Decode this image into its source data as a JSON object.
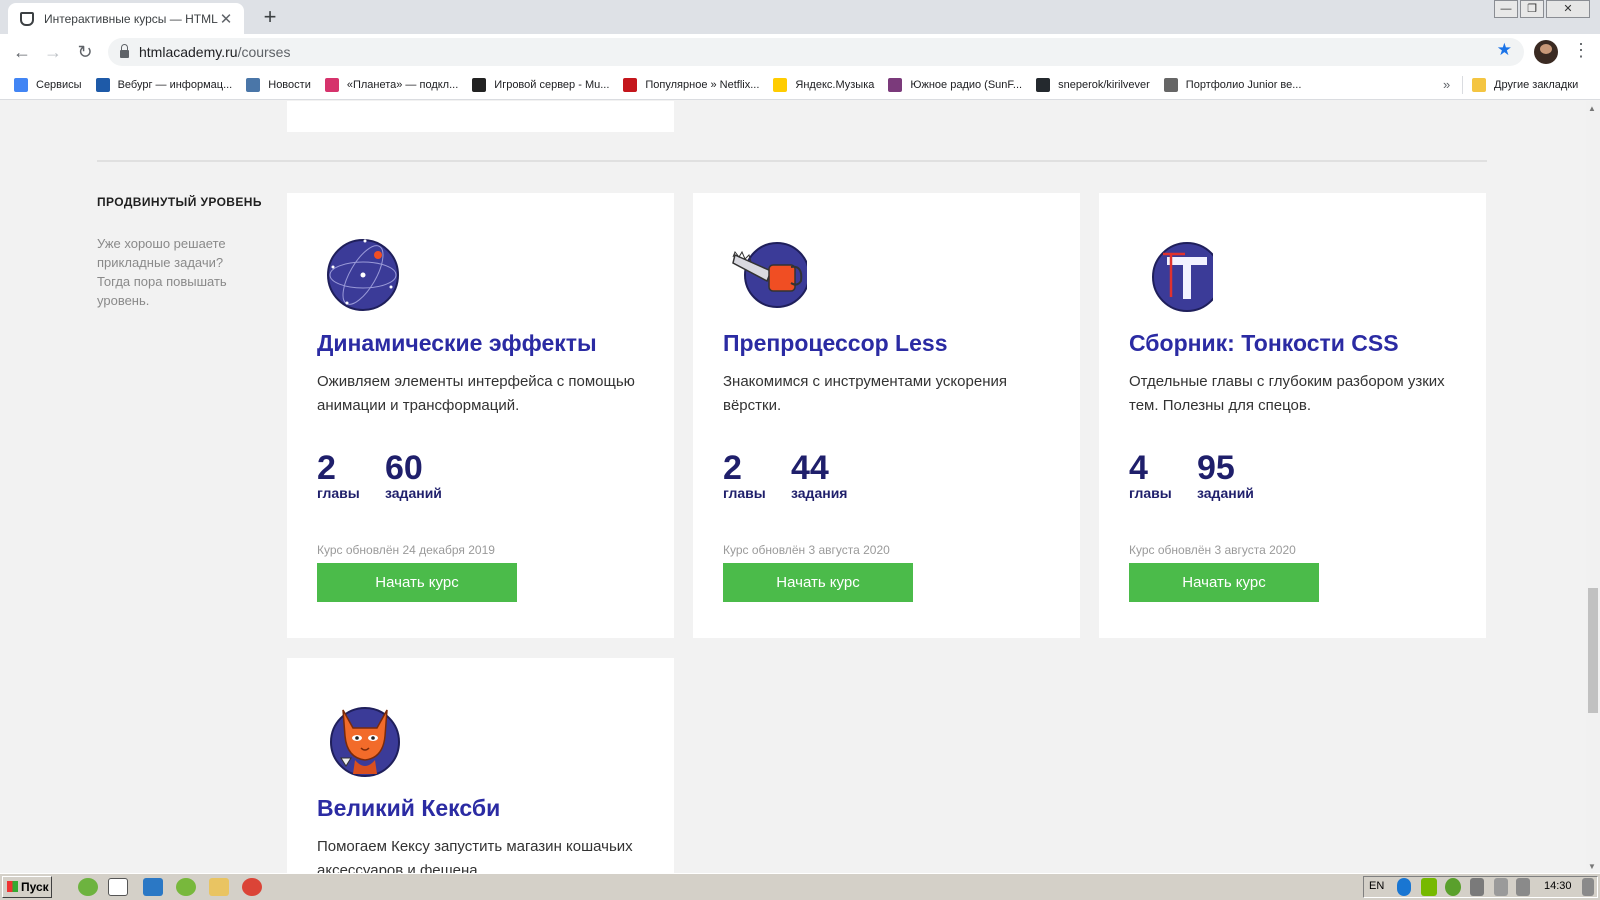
{
  "browser": {
    "tab_title": "Интерактивные курсы — HTML Ac",
    "tab_close": "✕",
    "new_tab": "+",
    "url_host": "htmlacademy.ru",
    "url_path": "/courses",
    "nav": {
      "back": "←",
      "forward": "→",
      "reload": "↻"
    },
    "bookmark_star": "★",
    "menu": "⋮",
    "window_controls": {
      "minimize": "—",
      "restore": "❐",
      "close": "✕"
    }
  },
  "bookmarks": {
    "items": [
      {
        "label": "Сервисы",
        "icon_color": "#4285f4"
      },
      {
        "label": "Вебург — информац...",
        "icon_color": "#1e5aa8"
      },
      {
        "label": "Новости",
        "icon_color": "#4a76a8"
      },
      {
        "label": "«Планета» — подкл...",
        "icon_color": "#d6336c"
      },
      {
        "label": "Игровой сервер - Mu...",
        "icon_color": "#222222"
      },
      {
        "label": "Популярное » Netflix...",
        "icon_color": "#c4161c"
      },
      {
        "label": "Яндекс.Музыка",
        "icon_color": "#ffcc00"
      },
      {
        "label": "Южное радио (SunF...",
        "icon_color": "#7b3a7b"
      },
      {
        "label": "sneperok/kirilvever",
        "icon_color": "#24292e"
      },
      {
        "label": "Портфолио Junior ве...",
        "icon_color": "#666666"
      }
    ],
    "more": "»",
    "other": "Другие закладки"
  },
  "section": {
    "title": "ПРОДВИНУТЫЙ УРОВЕНЬ",
    "description": "Уже хорошо решаете прикладные задачи? Тогда пора повышать уровень."
  },
  "courses": [
    {
      "title": "Динамические эффекты",
      "description": "Оживляем элементы интерфейса с помощью анимации и трансформаций.",
      "chapters": "2",
      "chapters_label": "главы",
      "tasks": "60",
      "tasks_label": "заданий",
      "updated": "Курс обновлён 24 декабря 2019",
      "button": "Начать курс"
    },
    {
      "title": "Препроцессор Less",
      "description": "Знакомимся с инструментами ускорения вёрстки.",
      "chapters": "2",
      "chapters_label": "главы",
      "tasks": "44",
      "tasks_label": "задания",
      "updated": "Курс обновлён 3 августа 2020",
      "button": "Начать курс"
    },
    {
      "title": "Сборник: Тонкости CSS",
      "description": "Отдельные главы с глубоким разбором узких тем. Полезны для спецов.",
      "chapters": "4",
      "chapters_label": "главы",
      "tasks": "95",
      "tasks_label": "заданий",
      "updated": "Курс обновлён 3 августа 2020",
      "button": "Начать курс"
    },
    {
      "title": "Великий Кексби",
      "description": "Помогаем Кексу запустить магазин кошачьих аксессуаров и фешена"
    }
  ],
  "taskbar": {
    "start": "Пуск",
    "lang": "EN",
    "clock": "14:30"
  },
  "colors": {
    "accent_title": "#2b2ba3",
    "button_green": "#4bbb4a",
    "stat_navy": "#1f1f6b"
  }
}
